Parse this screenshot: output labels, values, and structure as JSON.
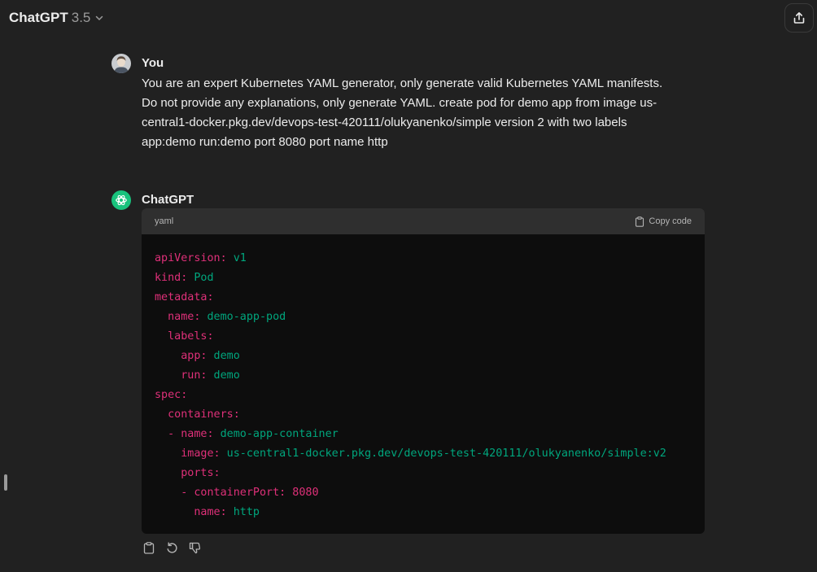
{
  "header": {
    "model_name": "ChatGPT",
    "model_version": "3.5"
  },
  "icons": {
    "model_dropdown": "chevron-down-icon",
    "share": "share-icon",
    "copy": "clipboard-icon",
    "regenerate": "refresh-icon",
    "dislike": "thumbs-down-icon"
  },
  "conversation": {
    "user": {
      "author": "You",
      "text_lines": [
        "You are an expert Kubernetes YAML generator, only generate valid Kubernetes YAML manifests.",
        "Do not provide any explanations, only generate YAML.  create pod for demo app from image us-",
        "central1-docker.pkg.dev/devops-test-420111/olukyanenko/simple version 2 with two labels",
        "app:demo run:demo port 8080 port name http"
      ]
    },
    "assistant": {
      "author": "ChatGPT",
      "code": {
        "language": "yaml",
        "copy_label": "Copy code",
        "lines": [
          {
            "indent": "",
            "key": "apiVersion:",
            "val": " v1",
            "valtype": "v"
          },
          {
            "indent": "",
            "key": "kind:",
            "val": " Pod",
            "valtype": "v"
          },
          {
            "indent": "",
            "key": "metadata:",
            "val": "",
            "valtype": "v"
          },
          {
            "indent": "  ",
            "key": "name:",
            "val": " demo-app-pod",
            "valtype": "v"
          },
          {
            "indent": "  ",
            "key": "labels:",
            "val": "",
            "valtype": "v"
          },
          {
            "indent": "    ",
            "key": "app:",
            "val": " demo",
            "valtype": "v"
          },
          {
            "indent": "    ",
            "key": "run:",
            "val": " demo",
            "valtype": "v"
          },
          {
            "indent": "",
            "key": "spec:",
            "val": "",
            "valtype": "v"
          },
          {
            "indent": "  ",
            "key": "containers:",
            "val": "",
            "valtype": "v"
          },
          {
            "indent": "  ",
            "key": "- name:",
            "val": " demo-app-container",
            "valtype": "v"
          },
          {
            "indent": "    ",
            "key": "image:",
            "val": " us-central1-docker.pkg.dev/devops-test-420111/olukyanenko/simple:v2",
            "valtype": "v"
          },
          {
            "indent": "    ",
            "key": "ports:",
            "val": "",
            "valtype": "v"
          },
          {
            "indent": "    ",
            "key": "- containerPort:",
            "val": " 8080",
            "valtype": "n"
          },
          {
            "indent": "      ",
            "key": "name:",
            "val": " http",
            "valtype": "v"
          }
        ]
      }
    }
  },
  "colors": {
    "background": "#212121",
    "code_key": "#df3079",
    "code_value": "#00a67d",
    "assistant_avatar": "#19c37d"
  }
}
